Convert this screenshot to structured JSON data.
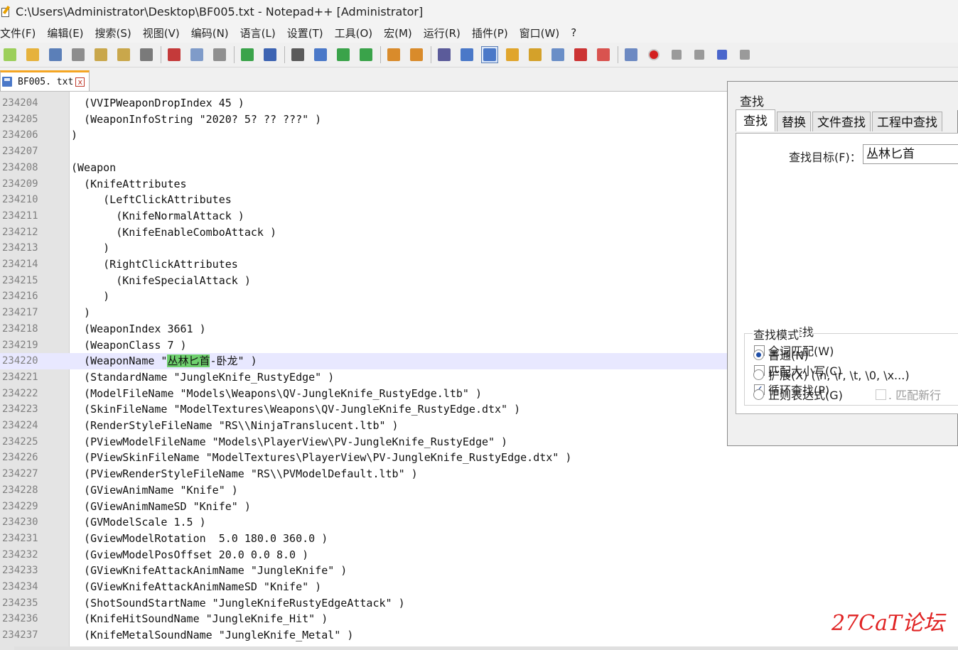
{
  "window": {
    "title": "C:\\Users\\Administrator\\Desktop\\BF005.txt - Notepad++ [Administrator]"
  },
  "menu": [
    "文件(F)",
    "编辑(E)",
    "搜索(S)",
    "视图(V)",
    "编码(N)",
    "语言(L)",
    "设置(T)",
    "工具(O)",
    "宏(M)",
    "运行(R)",
    "插件(P)",
    "窗口(W)",
    "?"
  ],
  "toolbar": {
    "icons": [
      "new-file-icon",
      "open-file-icon",
      "save-icon",
      "save-all-icon",
      "close-icon",
      "close-all-icon",
      "print-icon",
      "cut-icon",
      "copy-icon",
      "paste-icon",
      "undo-icon",
      "redo-icon",
      "find-icon",
      "replace-icon",
      "zoom-in-icon",
      "zoom-out-icon",
      "sync-vertical-icon",
      "sync-horizontal-icon",
      "word-wrap-icon",
      "show-all-chars-icon",
      "indent-guide-icon",
      "user-lang-icon",
      "doc-map-icon",
      "function-list-icon",
      "folder-workspace-icon",
      "monitoring-icon",
      "eye-icon",
      "record-macro-icon",
      "stop-record-icon",
      "play-macro-icon",
      "run-macro-multiple-icon",
      "save-macro-icon"
    ],
    "colors": {
      "accent": "#f5a623",
      "record": "#d32020",
      "highlight": "#6ed06e"
    }
  },
  "tab": {
    "label": "BF005. txt",
    "close": "x"
  },
  "editor": {
    "current_line": "234220",
    "lines": [
      {
        "n": "234204",
        "code": "  (VVIPWeaponDropIndex 45 )"
      },
      {
        "n": "234205",
        "code": "  (WeaponInfoString \"2020? 5? ?? ???\" )"
      },
      {
        "n": "234206",
        "code": ")"
      },
      {
        "n": "234207",
        "code": ""
      },
      {
        "n": "234208",
        "code": "(Weapon"
      },
      {
        "n": "234209",
        "code": "  (KnifeAttributes"
      },
      {
        "n": "234210",
        "code": "     (LeftClickAttributes"
      },
      {
        "n": "234211",
        "code": "       (KnifeNormalAttack )"
      },
      {
        "n": "234212",
        "code": "       (KnifeEnableComboAttack )"
      },
      {
        "n": "234213",
        "code": "     )"
      },
      {
        "n": "234214",
        "code": "     (RightClickAttributes"
      },
      {
        "n": "234215",
        "code": "       (KnifeSpecialAttack )"
      },
      {
        "n": "234216",
        "code": "     )"
      },
      {
        "n": "234217",
        "code": "  )"
      },
      {
        "n": "234218",
        "code": "  (WeaponIndex 3661 )"
      },
      {
        "n": "234219",
        "code": "  (WeaponClass 7 )"
      },
      {
        "n": "234220",
        "code_before": "  (WeaponName \"",
        "code_hl": "丛林匕首",
        "code_after": "-卧龙\" )"
      },
      {
        "n": "234221",
        "code": "  (StandardName \"JungleKnife_RustyEdge\" )"
      },
      {
        "n": "234222",
        "code": "  (ModelFileName \"Models\\Weapons\\QV-JungleKnife_RustyEdge.ltb\" )"
      },
      {
        "n": "234223",
        "code": "  (SkinFileName \"ModelTextures\\Weapons\\QV-JungleKnife_RustyEdge.dtx\" )"
      },
      {
        "n": "234224",
        "code": "  (RenderStyleFileName \"RS\\\\NinjaTranslucent.ltb\" )"
      },
      {
        "n": "234225",
        "code": "  (PViewModelFileName \"Models\\PlayerView\\PV-JungleKnife_RustyEdge\" )"
      },
      {
        "n": "234226",
        "code": "  (PViewSkinFileName \"ModelTextures\\PlayerView\\PV-JungleKnife_RustyEdge.dtx\" )"
      },
      {
        "n": "234227",
        "code": "  (PViewRenderStyleFileName \"RS\\\\PVModelDefault.ltb\" )"
      },
      {
        "n": "234228",
        "code": "  (GViewAnimName \"Knife\" )"
      },
      {
        "n": "234229",
        "code": "  (GViewAnimNameSD \"Knife\" )"
      },
      {
        "n": "234230",
        "code": "  (GVModelScale 1.5 )"
      },
      {
        "n": "234231",
        "code": "  (GviewModelRotation  5.0 180.0 360.0 )"
      },
      {
        "n": "234232",
        "code": "  (GviewModelPosOffset 20.0 0.0 8.0 )"
      },
      {
        "n": "234233",
        "code": "  (GViewKnifeAttackAnimName \"JungleKnife\" )"
      },
      {
        "n": "234234",
        "code": "  (GViewKnifeAttackAnimNameSD \"Knife\" )"
      },
      {
        "n": "234235",
        "code": "  (ShotSoundStartName \"JungleKnifeRustyEdgeAttack\" )"
      },
      {
        "n": "234236",
        "code": "  (KnifeHitSoundName \"JungleKnife_Hit\" )"
      },
      {
        "n": "234237",
        "code": "  (KnifeMetalSoundName \"JungleKnife_Metal\" )"
      }
    ]
  },
  "find_dialog": {
    "title": "查找",
    "tabs": [
      "查找",
      "替换",
      "文件查找",
      "工程中查找"
    ],
    "active_tab": "查找",
    "find_label": "查找目标(F)：",
    "find_value": "丛林匕首",
    "options": [
      {
        "label": "反向查找",
        "checked": false
      },
      {
        "label": "全词匹配(W)",
        "checked": false
      },
      {
        "label": "匹配大小写(C)",
        "checked": false
      },
      {
        "label": "循环查找(P)",
        "checked": true
      }
    ],
    "mode_label": "查找模式",
    "modes": [
      {
        "label": "普通(N)",
        "selected": true
      },
      {
        "label": "扩展(X) (\\n, \\r, \\t, \\0, \\x...)",
        "selected": false
      },
      {
        "label": "正则表达式(G)",
        "selected": false
      }
    ],
    "match_newline": {
      "label": ". 匹配新行",
      "checked": false
    }
  },
  "watermark": "27CaT论坛"
}
